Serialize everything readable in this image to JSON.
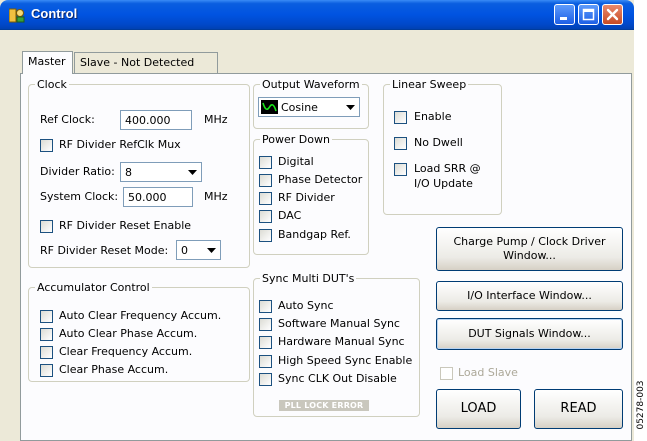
{
  "window": {
    "title": "Control",
    "colors": {
      "titlebar": "#0053e1",
      "close_button": "#c74b24",
      "face": "#ece9d8",
      "panel": "#fcfcfe"
    }
  },
  "tabs": [
    {
      "label": "Master",
      "active": true
    },
    {
      "label": "Slave - Not Detected",
      "active": false
    }
  ],
  "clock": {
    "legend": "Clock",
    "ref_clock_label": "Ref Clock:",
    "ref_clock_value": "400.000",
    "ref_clock_unit": "MHz",
    "rf_divider_mux_label": "RF Divider RefClk Mux",
    "divider_ratio_label": "Divider Ratio:",
    "divider_ratio_value": "8",
    "system_clock_label": "System Clock:",
    "system_clock_value": "50.000",
    "system_clock_unit": "MHz",
    "rf_divider_reset_enable_label": "RF Divider Reset Enable",
    "rf_divider_reset_mode_label": "RF Divider Reset Mode:",
    "rf_divider_reset_mode_value": "0"
  },
  "accumulator": {
    "legend": "Accumulator Control",
    "items": [
      "Auto Clear Frequency Accum.",
      "Auto Clear Phase Accum.",
      "Clear Frequency Accum.",
      "Clear Phase Accum."
    ]
  },
  "output_waveform": {
    "legend": "Output Waveform",
    "value": "Cosine",
    "icon": "waveform-icon"
  },
  "power_down": {
    "legend": "Power Down",
    "items": [
      "Digital",
      "Phase Detector",
      "RF Divider",
      "DAC",
      "Bandgap Ref."
    ]
  },
  "linear_sweep": {
    "legend": "Linear Sweep",
    "enable_label": "Enable",
    "no_dwell_label": "No Dwell",
    "load_srr_line1": "Load SRR @",
    "load_srr_line2": "I/O Update"
  },
  "sync": {
    "legend": "Sync Multi DUT's",
    "items": [
      "Auto Sync",
      "Software Manual Sync",
      "Hardware Manual Sync",
      "High Speed Sync Enable",
      "Sync CLK Out Disable"
    ],
    "pll_status": "PLL LOCK ERROR"
  },
  "buttons": {
    "charge_pump_line1": "Charge Pump / Clock Driver",
    "charge_pump_line2": "Window...",
    "io_interface": "I/O Interface Window...",
    "dut_signals": "DUT Signals Window...",
    "load_slave": "Load Slave",
    "load": "LOAD",
    "read": "READ"
  },
  "figure_id": "05278-003"
}
